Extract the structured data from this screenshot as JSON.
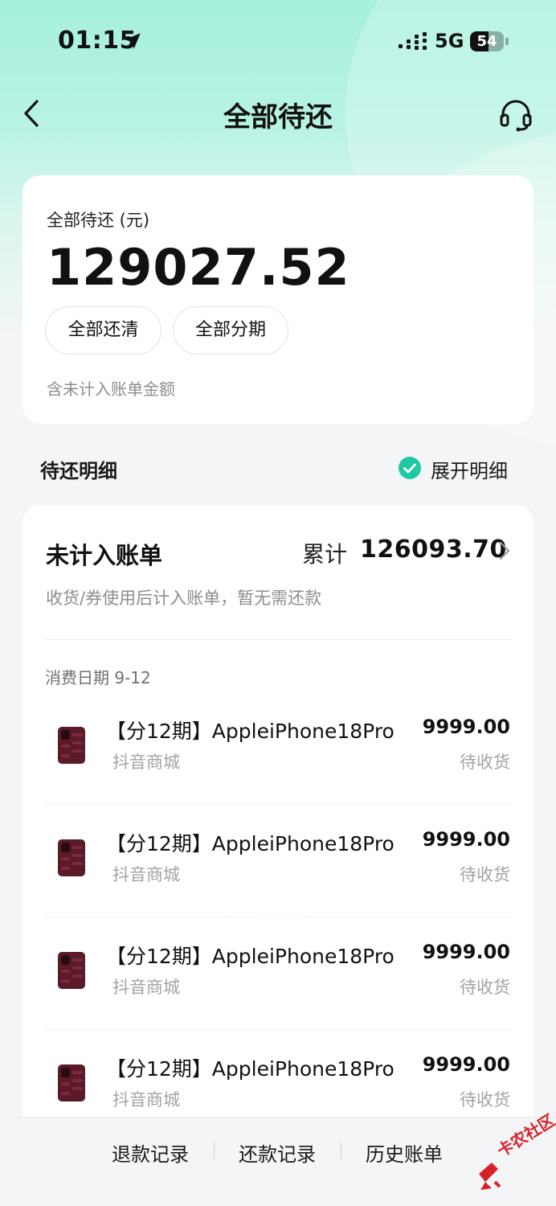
{
  "status_bar": {
    "time": "01:15",
    "network": "5G",
    "battery_percent": 54,
    "battery_label": "54"
  },
  "nav": {
    "title": "全部待还",
    "back_icon": "chevron-left-icon",
    "service_icon": "headset-icon"
  },
  "summary": {
    "label": "全部待还 (元)",
    "amount": "129027.52",
    "buttons": [
      "全部还清",
      "全部分期"
    ],
    "note": "含未计入账单金额"
  },
  "details": {
    "title": "待还明细",
    "expand_label": "展开明细",
    "expand_checked": true
  },
  "bill": {
    "title": "未计入账单",
    "total_label": "累计",
    "total_value": "126093.70",
    "subtitle": "收货/券使用后计入账单，暂无需还款",
    "date_label": "消费日期 9-12",
    "items": [
      {
        "name": "【分12期】AppleiPhone18Pro",
        "shop": "抖音商城",
        "price": "9999.00",
        "state": "待收货"
      },
      {
        "name": "【分12期】AppleiPhone18Pro",
        "shop": "抖音商城",
        "price": "9999.00",
        "state": "待收货"
      },
      {
        "name": "【分12期】AppleiPhone18Pro",
        "shop": "抖音商城",
        "price": "9999.00",
        "state": "待收货"
      },
      {
        "name": "【分12期】AppleiPhone18Pro",
        "shop": "抖音商城",
        "price": "9999.00",
        "state": "待收货"
      }
    ]
  },
  "bottom_nav": {
    "refund_records": "退款记录",
    "repayment_records": "还款记录",
    "history_bills": "历史账单"
  },
  "watermark": {
    "text": "卡农社区"
  },
  "colors": {
    "accent": "#1fc9a6",
    "header_bg": "#a6f0de",
    "page_bg": "#f4f5f7"
  }
}
